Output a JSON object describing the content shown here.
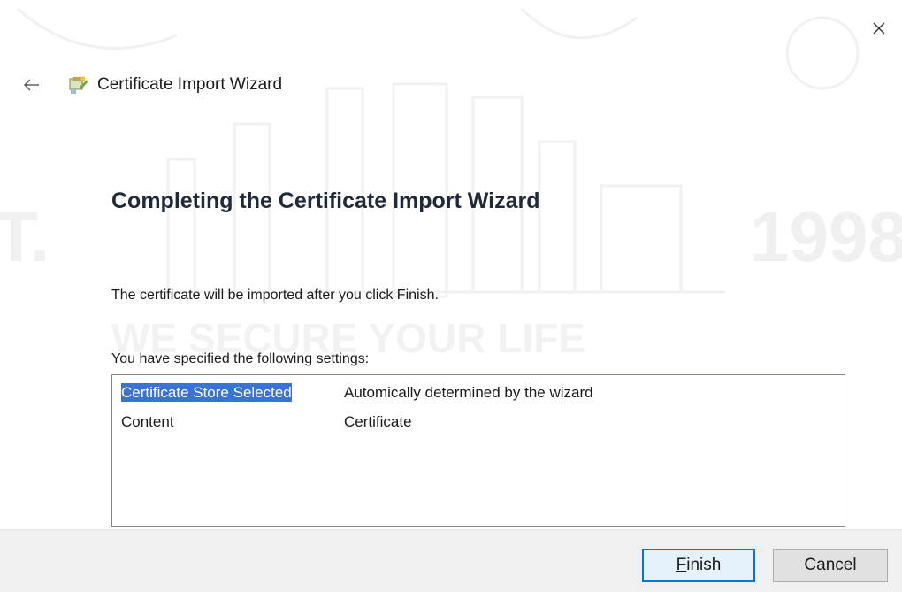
{
  "window": {
    "title": "Certificate Import Wizard",
    "close_icon": "close-icon",
    "back_icon": "back-arrow-icon",
    "app_icon": "certificate-wizard-icon"
  },
  "page": {
    "heading": "Completing the Certificate Import Wizard",
    "description": "The certificate will be imported after you click Finish.",
    "settings_label": "You have specified the following settings:"
  },
  "settings": [
    {
      "key": "Certificate Store Selected",
      "value": "Automically determined by the wizard",
      "selected": true
    },
    {
      "key": "Content",
      "value": "Certificate",
      "selected": false
    }
  ],
  "buttons": {
    "finish_accel": "F",
    "finish_rest": "inish",
    "cancel": "Cancel"
  },
  "watermark": {
    "text_right": "1998",
    "text_left": "T.",
    "slogan": "WE SECURE YOUR LIFE"
  },
  "colors": {
    "selection": "#3a73d0",
    "default_button_border": "#0078d7",
    "heading": "#1e2a3a"
  }
}
